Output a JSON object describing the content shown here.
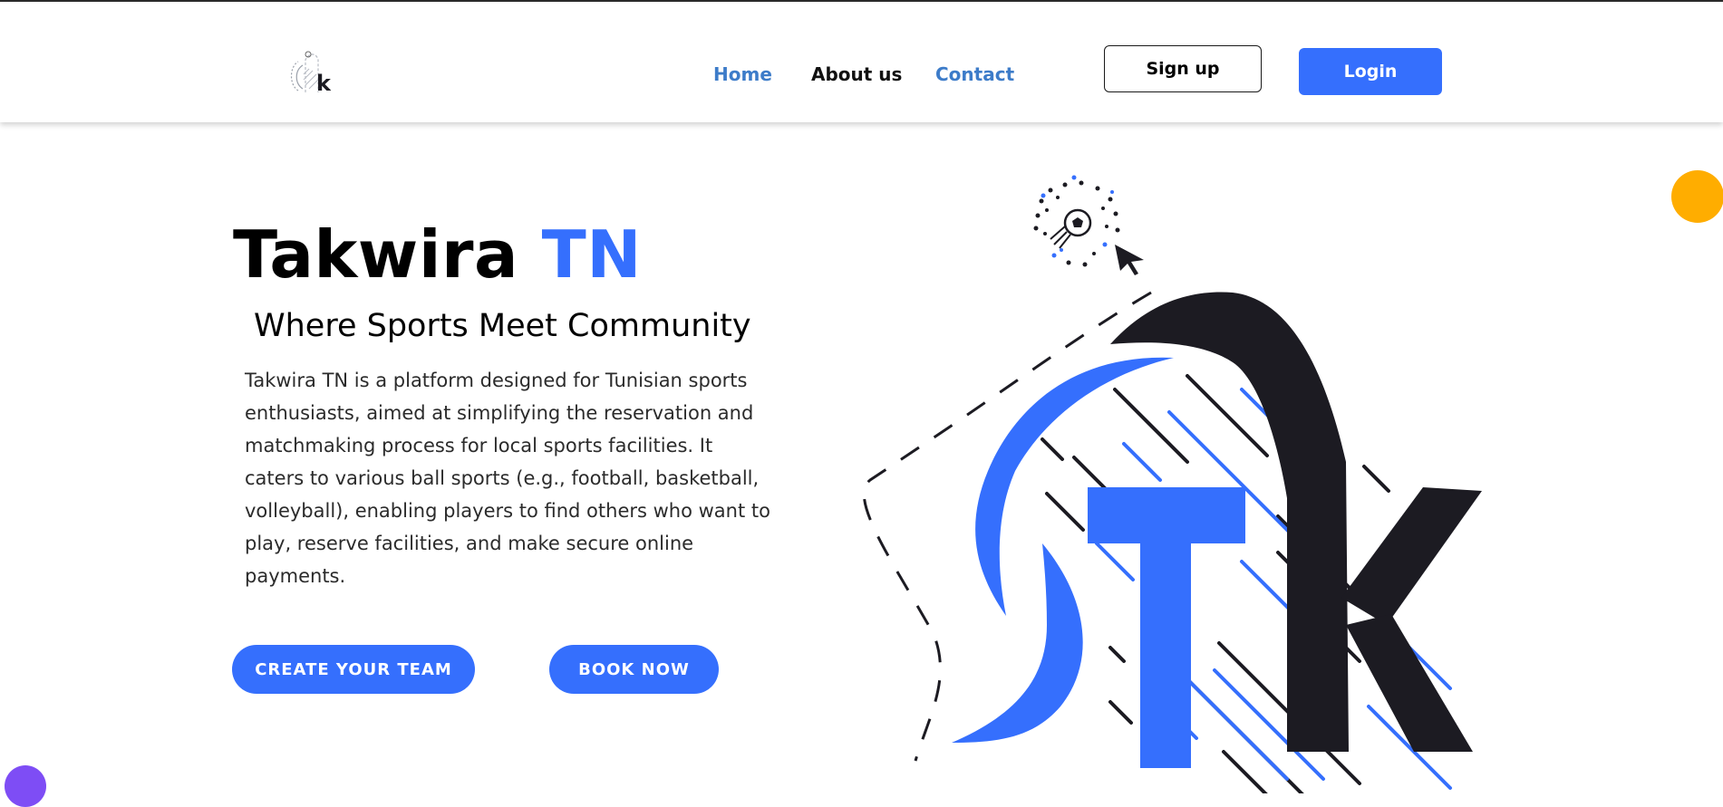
{
  "colors": {
    "accent": "#356ffd",
    "link": "#3d7cc9",
    "dark": "#1c1b22",
    "orange": "#ffad00",
    "purple": "#7e4df5"
  },
  "nav": {
    "logo_icon": "tk-logo-icon",
    "home": "Home",
    "about": "About us",
    "contact": "Contact",
    "signup": "Sign up",
    "login": "Login"
  },
  "hero": {
    "title_main": "Takwira ",
    "title_accent": "TN",
    "subtitle": "Where Sports Meet Community",
    "description": "Takwira TN is a platform designed for Tunisian sports enthusiasts, aimed at simplifying the reservation and matchmaking process for local sports facilities. It caters to various ball sports (e.g., football, basketball, volleyball), enabling players to find others who want to play, reserve facilities, and make secure online payments.",
    "create_team": "CREATE YOUR TEAM",
    "book_now": "BOOK NOW",
    "illustration_icon": "tk-logo-illustration-icon",
    "ball_icon": "soccer-ball-icon",
    "cursor_icon": "cursor-arrow-icon"
  }
}
